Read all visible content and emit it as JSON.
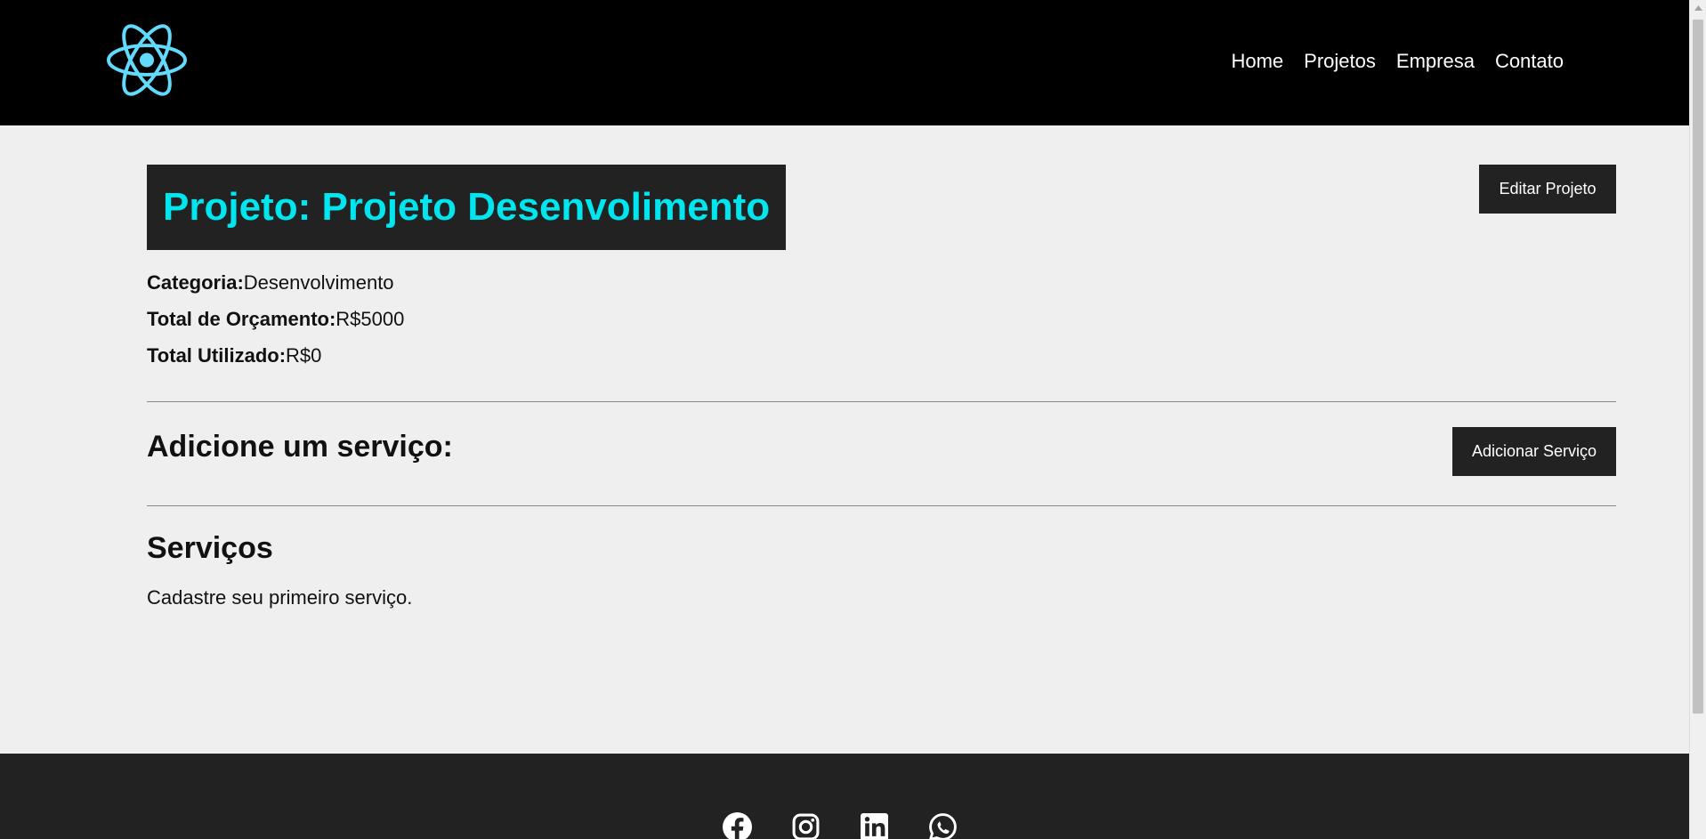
{
  "nav": {
    "logo": "react-logo",
    "links": [
      "Home",
      "Projetos",
      "Empresa",
      "Contato"
    ]
  },
  "project": {
    "title": "Projeto: Projeto Desenvolimento",
    "edit_button": "Editar Projeto",
    "category_label": "Categoria:",
    "category_value": "Desenvolvimento",
    "budget_label": "Total de Orçamento:",
    "budget_value": "R$5000",
    "used_label": "Total Utilizado:",
    "used_value": "R$0"
  },
  "service_form": {
    "title": "Adicione um serviço:",
    "add_button": "Adicionar Serviço"
  },
  "services": {
    "title": "Serviços",
    "empty_message": "Cadastre seu primeiro serviço."
  },
  "footer": {
    "social_icons": [
      "facebook-icon",
      "instagram-icon",
      "linkedin-icon",
      "whatsapp-icon"
    ]
  },
  "colors": {
    "navbar": "#000000",
    "accent_title": "#00e5ee",
    "dark_box": "#222222",
    "page_bg": "#efefef",
    "logo": "#61dafb"
  }
}
